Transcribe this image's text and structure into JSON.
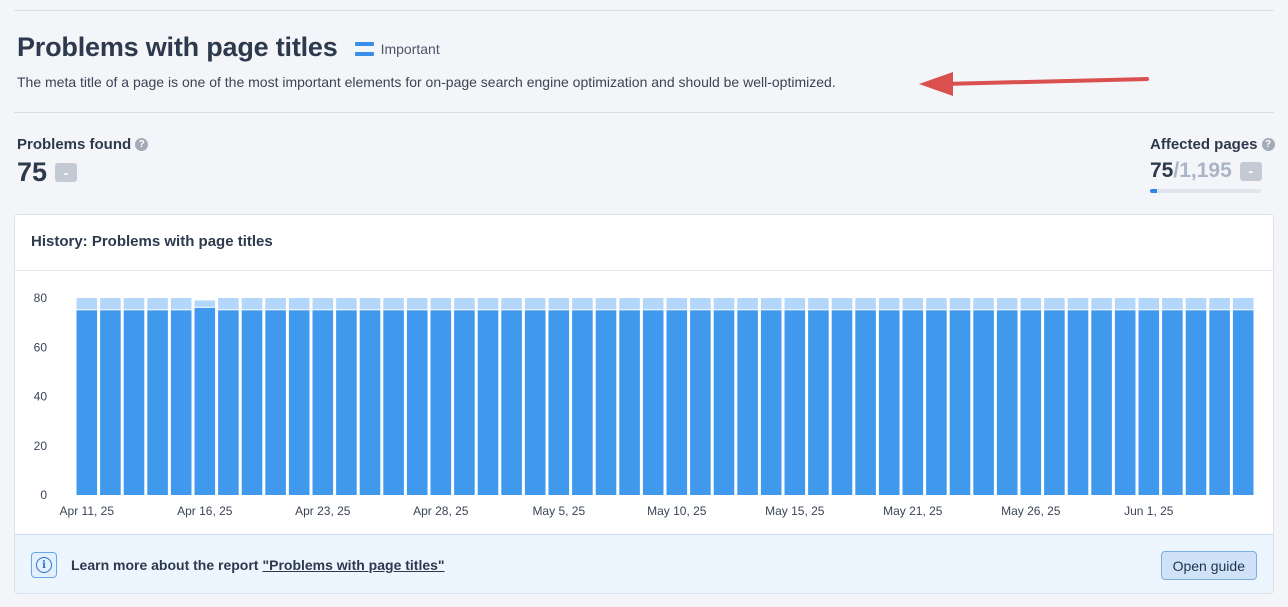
{
  "header": {
    "title": "Problems with page titles",
    "importance_label": "Important",
    "description": "The meta title of a page is one of the most important elements for on-page search engine optimization and should be well-optimized."
  },
  "problems_found": {
    "label": "Problems found",
    "value": "75",
    "delta": "-"
  },
  "affected_pages": {
    "label": "Affected pages",
    "value": "75",
    "total": "/1,195",
    "delta": "-",
    "progress_fraction": 0.063
  },
  "history": {
    "title": "History: Problems with page titles"
  },
  "chart_data": {
    "type": "bar",
    "stacked": true,
    "ylim": [
      0,
      80
    ],
    "yticks": [
      0,
      20,
      40,
      60,
      80
    ],
    "xtick_labels": [
      "Apr 11, 25",
      "Apr 16, 25",
      "Apr 23, 25",
      "Apr 28, 25",
      "May 5, 25",
      "May 10, 25",
      "May 15, 25",
      "May 21, 25",
      "May 26, 25",
      "Jun 1, 25"
    ],
    "xtick_bar_index": [
      0,
      5,
      10,
      15,
      20,
      25,
      30,
      35,
      40,
      45
    ],
    "bar_count": 50,
    "series": [
      {
        "color": "#4199ee",
        "values": [
          75,
          75,
          75,
          75,
          75,
          76,
          75,
          75,
          75,
          75,
          75,
          75,
          75,
          75,
          75,
          75,
          75,
          75,
          75,
          75,
          75,
          75,
          75,
          75,
          75,
          75,
          75,
          75,
          75,
          75,
          75,
          75,
          75,
          75,
          75,
          75,
          75,
          75,
          75,
          75,
          75,
          75,
          75,
          75,
          75,
          75,
          75,
          75,
          75,
          75
        ]
      },
      {
        "color": "#b3d7fb",
        "values": [
          5,
          5,
          5,
          5,
          5,
          3,
          5,
          5,
          5,
          5,
          5,
          5,
          5,
          5,
          5,
          5,
          5,
          5,
          5,
          5,
          5,
          5,
          5,
          5,
          5,
          5,
          5,
          5,
          5,
          5,
          5,
          5,
          5,
          5,
          5,
          5,
          5,
          5,
          5,
          5,
          5,
          5,
          5,
          5,
          5,
          5,
          5,
          5,
          5,
          5
        ]
      }
    ],
    "grid": false
  },
  "footer": {
    "text": "Learn more about the report",
    "link": "\"Problems with page titles\"",
    "button": "Open guide"
  },
  "colors": {
    "accent": "#4199ee",
    "arrow": "#d9504f"
  },
  "icons": {
    "importance": "importance-bars-icon",
    "help": "question-circle-icon",
    "info": "info-icon"
  }
}
